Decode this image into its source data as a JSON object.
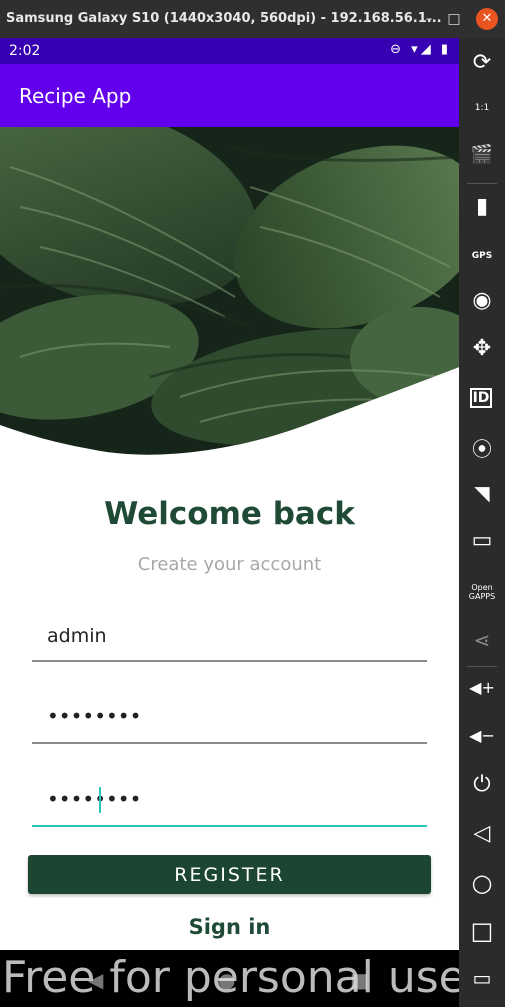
{
  "window": {
    "title": "Samsung Galaxy S10 (1440x3040, 560dpi) - 192.168.56.1...",
    "minimize": "–",
    "maximize": "□",
    "close": "✕"
  },
  "statusbar": {
    "time": "2:02",
    "icons": "⊖ ▾◢ ▮"
  },
  "appbar": {
    "title": "Recipe App"
  },
  "hero": {
    "description_icon": "leaf-image"
  },
  "content": {
    "heading": "Welcome back",
    "subtitle": "Create your account",
    "username_value": "admin",
    "password_value": "••••••••",
    "confirm_value": "••••••••",
    "register_label": "REGISTER",
    "signin_label": "Sign in"
  },
  "watermark": "Free for personal use",
  "toolbar": {
    "items": [
      {
        "icon": "rotate-icon",
        "glyph": "⟳"
      },
      {
        "icon": "scale-icon",
        "glyph": "1:1"
      },
      {
        "icon": "screencast-icon",
        "glyph": "🎬"
      },
      {
        "icon": "battery-icon",
        "glyph": "▮"
      },
      {
        "icon": "gps-icon",
        "glyph": "GPS"
      },
      {
        "icon": "camera-icon",
        "glyph": "◉"
      },
      {
        "icon": "move-icon",
        "glyph": "✥"
      },
      {
        "icon": "id-icon",
        "glyph": "ID"
      },
      {
        "icon": "media-icon",
        "glyph": "⦿"
      },
      {
        "icon": "cast-icon",
        "glyph": "◥"
      },
      {
        "icon": "sms-icon",
        "glyph": "▭"
      },
      {
        "icon": "opengapps-icon",
        "glyph": "Open GAPPS"
      },
      {
        "icon": "share-icon",
        "glyph": "⋖"
      },
      {
        "icon": "volume-up-icon",
        "glyph": "◀+"
      },
      {
        "icon": "volume-down-icon",
        "glyph": "◀−"
      },
      {
        "icon": "power-icon",
        "glyph": "⏻"
      },
      {
        "icon": "back-icon",
        "glyph": "◁"
      },
      {
        "icon": "home-icon",
        "glyph": "○"
      },
      {
        "icon": "recents-icon",
        "glyph": "□"
      },
      {
        "icon": "menu-icon",
        "glyph": "▭"
      }
    ]
  },
  "colors": {
    "accent": "#6200ee",
    "status": "#3700b3",
    "primary": "#1c4532",
    "focus": "#2bc4bd"
  }
}
